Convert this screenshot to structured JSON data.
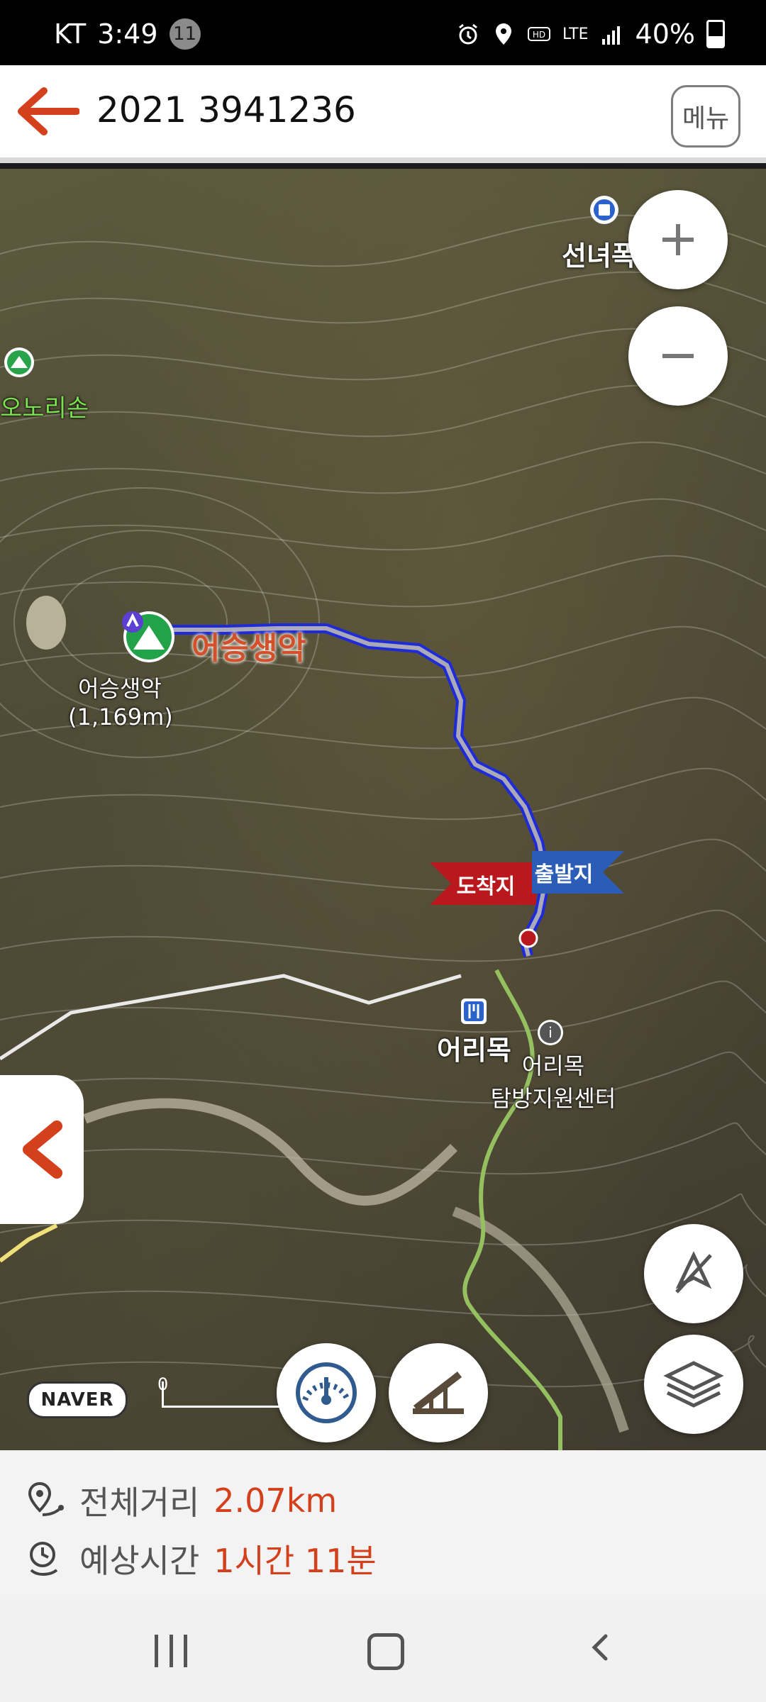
{
  "status_bar": {
    "carrier": "KT",
    "time": "3:49",
    "notification_count": "11",
    "network": "LTE",
    "battery": "40%"
  },
  "header": {
    "title": "2021 3941236",
    "menu_label": "메뉴"
  },
  "map": {
    "labels": {
      "peak_name": "어승생악",
      "peak_elevation": "(1,169m)",
      "route_label": "어승생악",
      "restaurant": "어리목",
      "center_line1": "어리목",
      "center_line2": "탐방지원센터",
      "waterfall": "선녀폭",
      "left_peak": "오노리손"
    },
    "flags": {
      "arrival": "도착지",
      "departure": "출발지"
    },
    "attribution": "NAVER",
    "scale_zero": "0"
  },
  "info": {
    "distance_label": "전체거리",
    "distance_value": "2.07km",
    "time_label": "예상시간",
    "time_value": "1시간 11분"
  },
  "colors": {
    "accent": "#d4401c",
    "route_blue": "#1f2bd6",
    "flag_red": "#b9191c",
    "flag_blue": "#2b5db7"
  }
}
